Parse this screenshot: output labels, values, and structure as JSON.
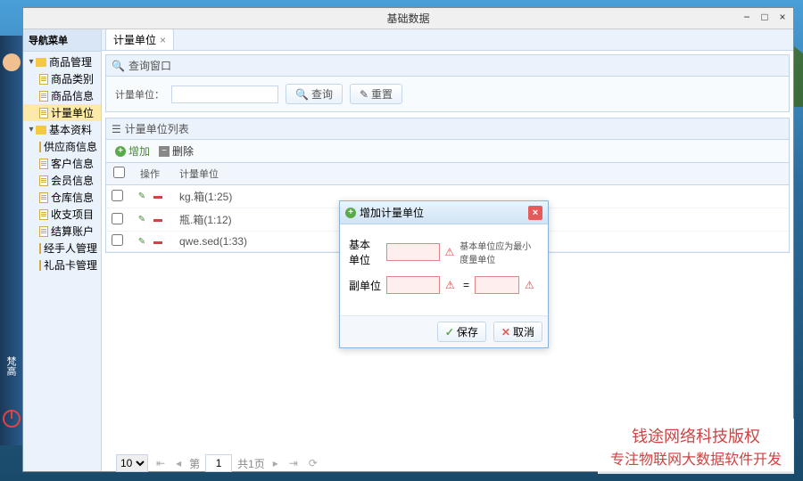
{
  "window": {
    "title": "基础数据"
  },
  "sidebar": {
    "header": "导航菜单",
    "groups": [
      {
        "label": "商品管理",
        "items": [
          "商品类别",
          "商品信息",
          "计量单位"
        ],
        "selected_index": 2
      },
      {
        "label": "基本资料",
        "items": [
          "供应商信息",
          "客户信息",
          "会员信息",
          "仓库信息",
          "收支项目",
          "结算账户",
          "经手人管理",
          "礼品卡管理"
        ]
      }
    ]
  },
  "tabs": {
    "active": "计量单位"
  },
  "search": {
    "section_title": "查询窗口",
    "label": "计量单位：",
    "query_btn": "查询",
    "reset_btn": "重置"
  },
  "list": {
    "section_title": "计量单位列表",
    "add_btn": "增加",
    "del_btn": "删除",
    "col_ops": "操作",
    "col_unit": "计量单位",
    "rows": [
      "kg.箱(1:25)",
      "瓶.箱(1:12)",
      "qwe.sed(1:33)"
    ]
  },
  "pager": {
    "page_size": "10",
    "page_label": "第",
    "page_num": "1",
    "total_label": "共1页"
  },
  "dialog": {
    "title": "增加计量单位",
    "field1_label": "基本单位",
    "field1_hint": "基本单位应为最小度量单位",
    "field2_label": "副单位",
    "equals": "=",
    "save_btn": "保存",
    "cancel_btn": "取消"
  },
  "left": {
    "label": "梵高"
  },
  "watermark": {
    "line1": "钱途网络科技版权",
    "line2": "专注物联网大数据软件开发"
  }
}
